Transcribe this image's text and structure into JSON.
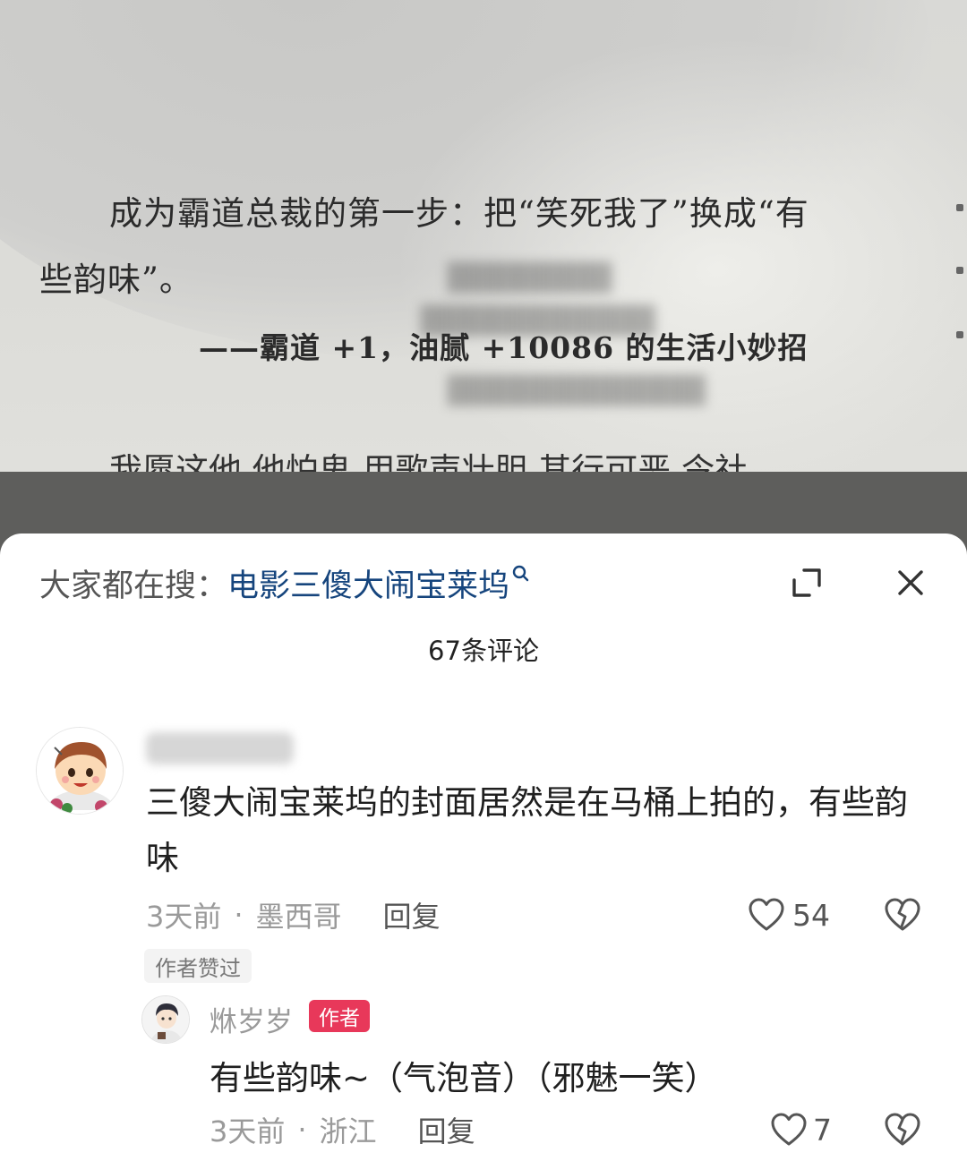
{
  "photo": {
    "line1": "成为霸道总裁的第一步：把“笑死我了”换成“有",
    "line2": "些韵味”。",
    "line3": "——霸道 +1，油腻 +10086 的生活小妙招",
    "cut_line": "我愿这他  他怕鬼  用歌声壮胆  其行可恶  令社"
  },
  "search_bar": {
    "prefix": "大家都在搜：",
    "term": "电影三傻大闹宝莱坞"
  },
  "comments_header": {
    "count_text": "67条评论"
  },
  "comments": [
    {
      "text": "三傻大闹宝莱坞的封面居然是在马桶上拍的，有些韵味",
      "time": "3天前",
      "location": "墨西哥",
      "reply_label": "回复",
      "likes": "54",
      "badge": "作者赞过",
      "replies": [
        {
          "username": "烌岁岁",
          "role_badge": "作者",
          "text": "有些韵味~（气泡音）（邪魅一笑）",
          "time": "3天前",
          "location": "浙江",
          "reply_label": "回复",
          "likes": "7"
        }
      ]
    }
  ],
  "colors": {
    "search_term": "#16457d",
    "author_badge": "#e8385a",
    "meta_gray": "#9a9a9a"
  },
  "icons": {
    "search": "search-icon",
    "expand": "expand-icon",
    "close": "close-icon",
    "like": "heart-icon",
    "dislike": "broken-heart-icon"
  }
}
